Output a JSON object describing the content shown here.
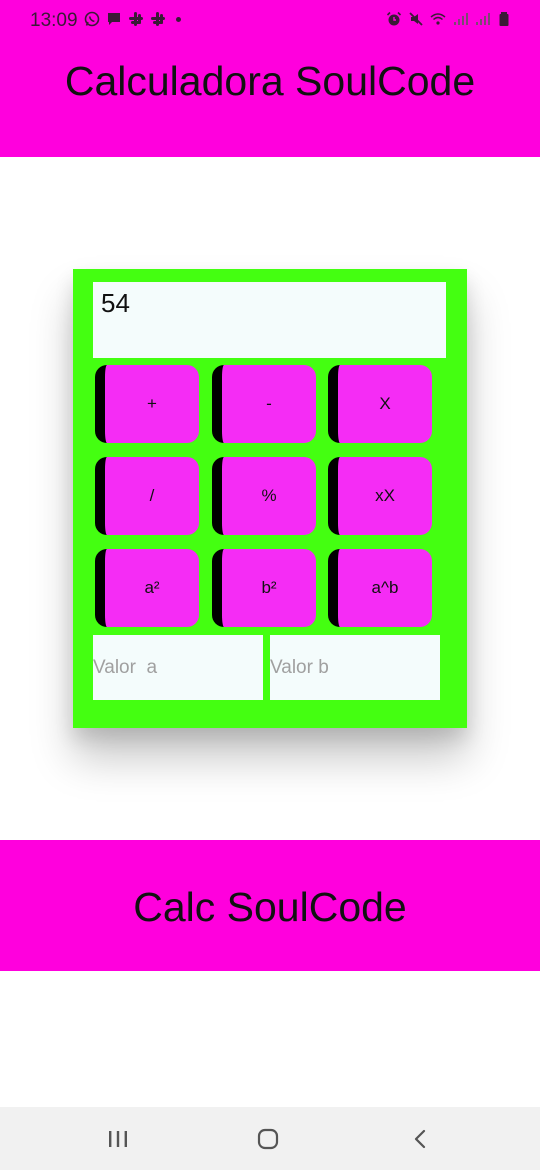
{
  "status_bar": {
    "time": "13:09",
    "left_icons": [
      "whatsapp-icon",
      "message-icon",
      "slack-icon",
      "slack-icon",
      "notification-dot-icon"
    ],
    "right_icons": [
      "alarm-icon",
      "mute-icon",
      "wifi-icon",
      "signal-icon",
      "signal-icon",
      "battery-icon"
    ]
  },
  "header": {
    "title": "Calculadora SoulCode"
  },
  "calculator": {
    "display_value": "54",
    "keys": [
      "+",
      "-",
      "X",
      "/",
      "%",
      "xX",
      "a²",
      "b²",
      "a^b"
    ],
    "input_a_placeholder": "Valor  a",
    "input_b_placeholder": "Valor b"
  },
  "footer": {
    "title": "Calc SoulCode"
  },
  "nav_bar": {
    "buttons": [
      "recent-apps-icon",
      "home-icon",
      "back-icon"
    ]
  },
  "colors": {
    "brand": "#ff00dd",
    "panel": "#44ff11",
    "key": "#f52cf5",
    "field": "#f4fcfc"
  }
}
